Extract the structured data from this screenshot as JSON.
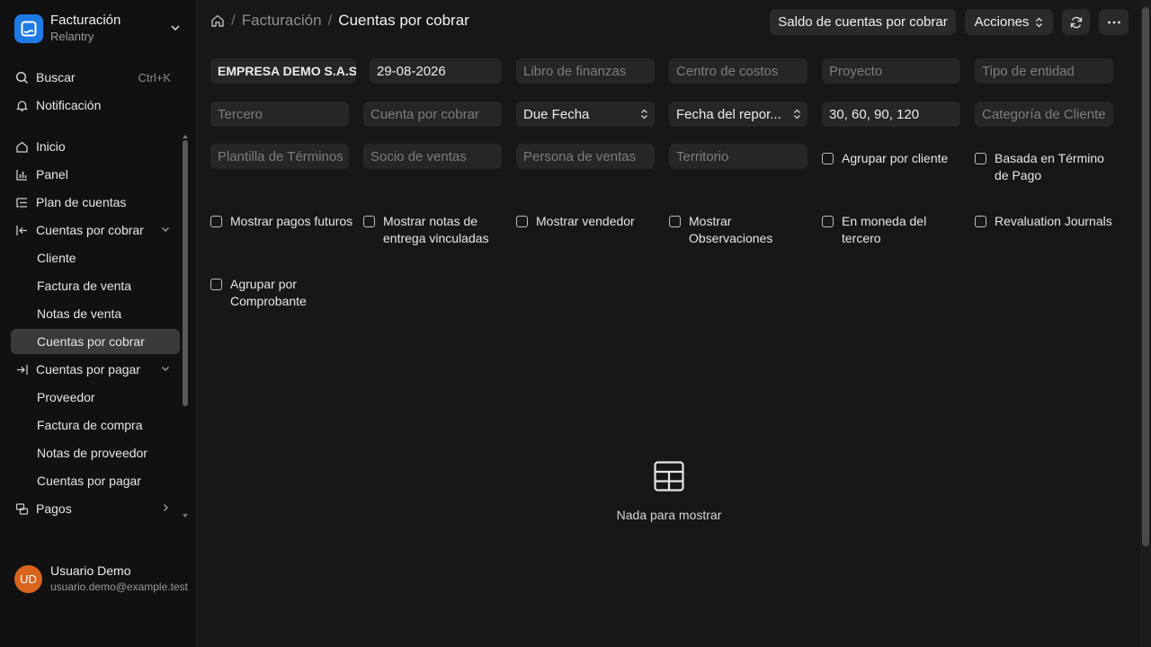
{
  "sidebar": {
    "app_title": "Facturación",
    "app_subtitle": "Relantry",
    "search_label": "Buscar",
    "search_shortcut": "Ctrl+K",
    "notification_label": "Notificación",
    "items": [
      {
        "label": "Inicio"
      },
      {
        "label": "Panel"
      },
      {
        "label": "Plan de cuentas"
      },
      {
        "label": "Cuentas por cobrar"
      },
      {
        "label": "Cliente"
      },
      {
        "label": "Factura de venta"
      },
      {
        "label": "Notas de venta"
      },
      {
        "label": "Cuentas por cobrar"
      },
      {
        "label": "Cuentas por pagar"
      },
      {
        "label": "Proveedor"
      },
      {
        "label": "Factura de compra"
      },
      {
        "label": "Notas de proveedor"
      },
      {
        "label": "Cuentas por pagar"
      },
      {
        "label": "Pagos"
      }
    ],
    "user": {
      "initials": "UD",
      "name": "Usuario Demo",
      "email": "usuario.demo@example.test"
    }
  },
  "header": {
    "breadcrumb_parent": "Facturación",
    "breadcrumb_sep": "/",
    "title": "Cuentas por cobrar",
    "report_button": "Saldo de cuentas por cobrar",
    "actions_button": "Acciones"
  },
  "filters": {
    "company": "EMPRESA DEMO S.A.S.",
    "date": "29-08-2026",
    "finance_book": "Libro de finanzas",
    "cost_center": "Centro de costos",
    "project": "Proyecto",
    "entity_type": "Tipo de entidad",
    "party": "Tercero",
    "receivable_account": "Cuenta por cobrar",
    "ageing_based_on": "Due Fecha",
    "report_date": "Fecha del repor...",
    "ageing_ranges": "30, 60, 90, 120",
    "customer_group": "Categoría de Cliente",
    "terms_template": "Plantilla de Términos",
    "sales_partner": "Socio de ventas",
    "sales_person": "Persona de ventas",
    "territory": "Territorio"
  },
  "checks": {
    "group_by_customer": "Agrupar por cliente",
    "based_on_payment_terms": "Basada en Término de Pago",
    "show_future_payments": "Mostrar pagos futuros",
    "show_delivery_notes": "Mostrar notas de entrega vinculadas",
    "show_sales_person": "Mostrar vendedor",
    "show_remarks": "Mostrar Observaciones",
    "party_currency": "En moneda del tercero",
    "revaluation_journals": "Revaluation Journals",
    "group_by_voucher": "Agrupar por Comprobante"
  },
  "empty_state": {
    "text": "Nada para mostrar"
  },
  "colors": {
    "accent": "#1f7ae6",
    "avatar": "#d9641e",
    "background": "#171717",
    "sidebar": "#111111"
  }
}
